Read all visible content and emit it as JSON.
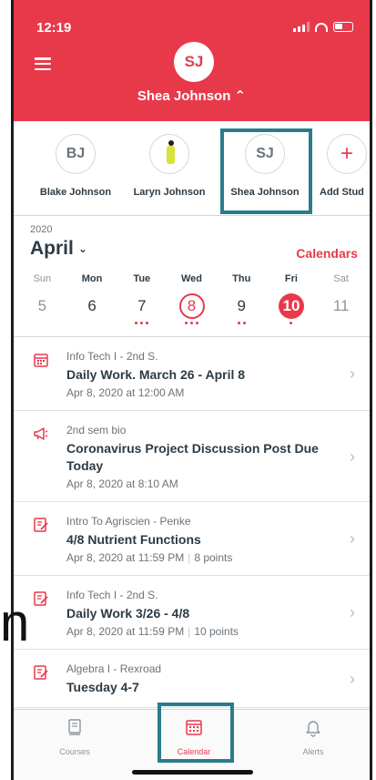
{
  "status_bar": {
    "time": "12:19"
  },
  "header": {
    "avatar_initials": "SJ",
    "name": "Shea Johnson ⌃"
  },
  "students": [
    {
      "initials": "BJ",
      "name": "Blake Johnson"
    },
    {
      "initials": "",
      "name": "Laryn Johnson"
    },
    {
      "initials": "SJ",
      "name": "Shea Johnson"
    },
    {
      "initials": "+",
      "name": "Add Stud"
    }
  ],
  "calendar": {
    "year": "2020",
    "month": "April",
    "calendars_link": "Calendars",
    "days": [
      {
        "name": "Sun",
        "date": "5"
      },
      {
        "name": "Mon",
        "date": "6"
      },
      {
        "name": "Tue",
        "date": "7"
      },
      {
        "name": "Wed",
        "date": "8"
      },
      {
        "name": "Thu",
        "date": "9"
      },
      {
        "name": "Fri",
        "date": "10"
      },
      {
        "name": "Sat",
        "date": "11"
      }
    ]
  },
  "items": [
    {
      "icon": "calendar-icon",
      "course": "Info Tech  I - 2nd S.",
      "title": "Daily Work.    March 26 - April 8",
      "date": "Apr 8, 2020 at 12:00 AM",
      "points": ""
    },
    {
      "icon": "megaphone-icon",
      "course": "2nd sem bio",
      "title": "Coronavirus Project Discussion Post Due Today",
      "date": "Apr 8, 2020 at 8:10 AM",
      "points": ""
    },
    {
      "icon": "assignment-icon",
      "course": "Intro To Agriscien - Penke",
      "title": "4/8 Nutrient Functions",
      "date": "Apr 8, 2020 at 11:59 PM",
      "points": "8 points"
    },
    {
      "icon": "assignment-icon",
      "course": "Info Tech  I - 2nd S.",
      "title": "Daily Work 3/26 - 4/8",
      "date": "Apr 8, 2020 at 11:59 PM",
      "points": "10 points"
    },
    {
      "icon": "assignment-icon",
      "course": "Algebra I - Rexroad",
      "title": "Tuesday 4-7",
      "date": "",
      "points": ""
    }
  ],
  "tabs": [
    {
      "label": "Courses"
    },
    {
      "label": "Calendar"
    },
    {
      "label": "Alerts"
    }
  ],
  "overflow_glyph": "n",
  "colors": {
    "accent": "#e8394b",
    "highlight_box": "#2b7c8a"
  }
}
